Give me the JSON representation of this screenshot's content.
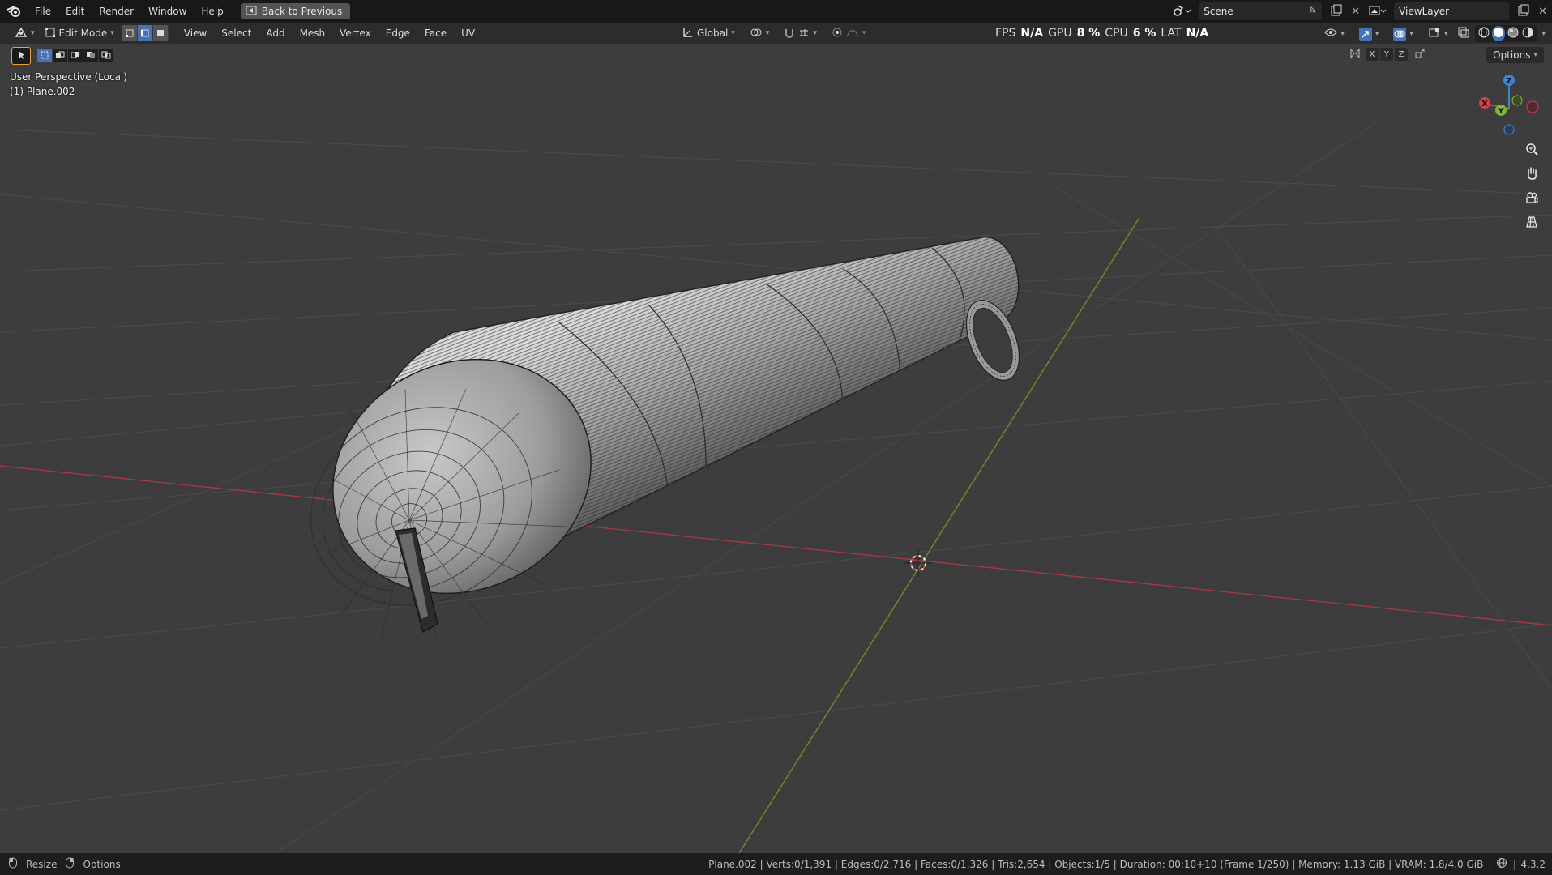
{
  "topbar": {
    "menus": [
      "File",
      "Edit",
      "Render",
      "Window",
      "Help"
    ],
    "back_button": "Back to Previous",
    "scene": "Scene",
    "view_layer": "ViewLayer"
  },
  "header": {
    "mode": "Edit Mode",
    "menus": [
      "View",
      "Select",
      "Add",
      "Mesh",
      "Vertex",
      "Edge",
      "Face",
      "UV"
    ],
    "transform_orientation": "Global",
    "stats": {
      "fps_label": "FPS",
      "fps": "N/A",
      "gpu_label": "GPU",
      "gpu": "8 %",
      "cpu_label": "CPU",
      "cpu": "6 %",
      "lat_label": "LAT",
      "lat": "N/A"
    },
    "options": "Options",
    "mirror_axes": [
      "X",
      "Y",
      "Z"
    ]
  },
  "viewport": {
    "view_name": "User Perspective (Local)",
    "object_name": "(1) Plane.002",
    "gizmo_axes": [
      "Z",
      "X",
      "Y"
    ]
  },
  "statusbar": {
    "left": [
      "Resize",
      "Options"
    ],
    "info": "Plane.002 | Verts:0/1,391 | Edges:0/2,716 | Faces:0/1,326 | Tris:2,654 | Objects:1/5 | Duration: 00:10+10 (Frame 1/250) | Memory: 1.13 GiB | VRAM: 1.8/4.0 GiB",
    "version": "4.3.2"
  },
  "colors": {
    "selection_accent": "#4772b3",
    "x_axis": "#d2424a",
    "y_axis": "#7fb82f",
    "z_axis": "#3f85d6",
    "mesh_wire": "#222222"
  },
  "icons": [
    "blender-logo-icon",
    "back-icon",
    "scene-icon",
    "view-layer-icon",
    "editor-type-icon",
    "edit-mode-icon",
    "vertex-select-icon",
    "edge-select-icon",
    "face-select-icon",
    "orientation-icon",
    "pivot-icon",
    "snap-icon",
    "proportional-icon",
    "visibility-icon",
    "gizmo-icon",
    "overlay-icon",
    "xray-icon",
    "shading-wire-icon",
    "shading-solid-icon",
    "shading-material-icon",
    "shading-rendered-icon",
    "select-box-icon",
    "zoom-icon",
    "pan-hand-icon",
    "camera-icon",
    "grid-icon",
    "3d-cursor-icon",
    "mouse-icon",
    "network-icon"
  ]
}
